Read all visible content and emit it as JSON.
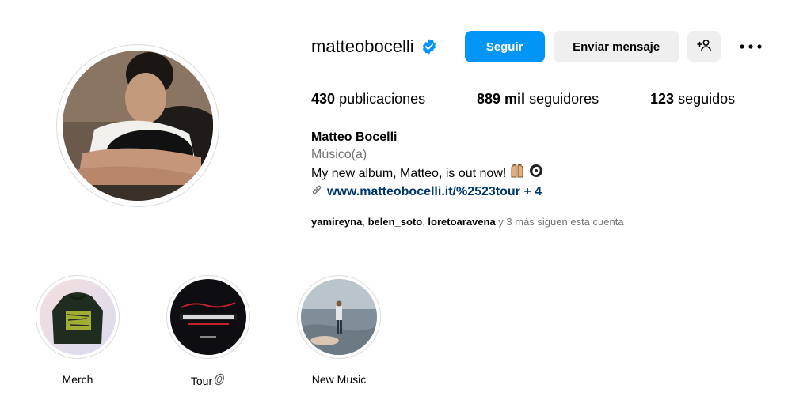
{
  "profile": {
    "username": "matteobocelli",
    "verified": true,
    "follow_label": "Seguir",
    "message_label": "Enviar mensaje",
    "adduser_icon": "add-user-icon",
    "more_icon": "more-options-icon"
  },
  "stats": {
    "posts_count": "430",
    "posts_label": "publicaciones",
    "followers_count": "889 mil",
    "followers_label": "seguidores",
    "following_count": "123",
    "following_label": "seguidos"
  },
  "bio": {
    "name": "Matteo Bocelli",
    "category": "Músico(a)",
    "text": "My new album, Matteo, is out now!",
    "link": "www.matteobocelli.it/%2523tour + 4"
  },
  "followed_by": {
    "users": [
      "yamireyna",
      "belen_soto",
      "loretoaravena"
    ],
    "sep": ", ",
    "suffix": " y 3 más siguen esta cuenta"
  },
  "highlights": [
    {
      "label": "Merch"
    },
    {
      "label": "Tour"
    },
    {
      "label": "New Music"
    }
  ],
  "colors": {
    "accent": "#0095f6",
    "link": "#00376b",
    "secondary_text": "#737373",
    "button_gray": "#efefef"
  }
}
